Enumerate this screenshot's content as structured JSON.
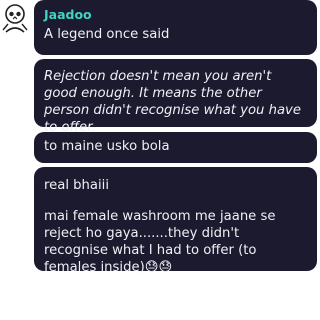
{
  "chat": {
    "messages": [
      {
        "sender": "Jaadoo",
        "text": "A legend once said"
      },
      {
        "text": "Rejection doesn't mean you aren't good enough. It means the other person didn't recognise what you have to offer."
      },
      {
        "text": "to maine usko bola"
      },
      {
        "line1": "real bhaiii",
        "line2": "mai female washroom me jaane se reject ho gaya.......they didn't recognise what I had to offer (to females inside)😓😓"
      }
    ]
  },
  "icons": {
    "avatar": "skull-avatar-icon"
  },
  "colors": {
    "bubble": "#1c1a2e",
    "sender": "#3fd3c4",
    "text": "#f0eff5"
  }
}
